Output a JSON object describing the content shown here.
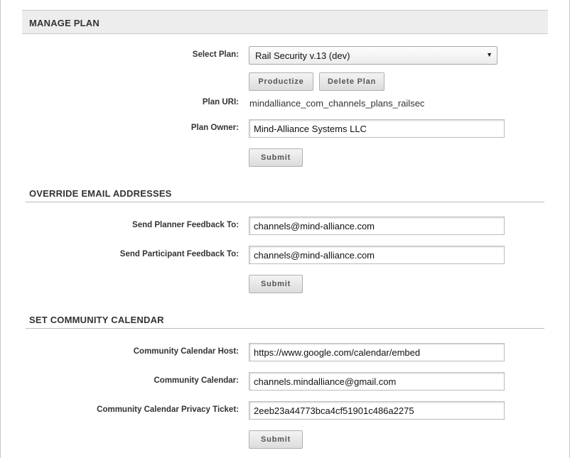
{
  "manage_plan": {
    "title": "MANAGE PLAN",
    "select_plan_label": "Select Plan:",
    "selected_plan": "Rail Security v.13 (dev)",
    "productize_label": "Productize",
    "delete_plan_label": "Delete Plan",
    "plan_uri_label": "Plan URI:",
    "plan_uri_value": "mindalliance_com_channels_plans_railsec",
    "plan_owner_label": "Plan Owner:",
    "plan_owner_value": "Mind-Alliance Systems LLC",
    "submit_label": "Submit"
  },
  "override_email": {
    "title": "OVERRIDE EMAIL ADDRESSES",
    "planner_feedback_label": "Send Planner Feedback To:",
    "planner_feedback_value": "channels@mind-alliance.com",
    "participant_feedback_label": "Send Participant Feedback To:",
    "participant_feedback_value": "channels@mind-alliance.com",
    "submit_label": "Submit"
  },
  "community_calendar": {
    "title": "SET COMMUNITY CALENDAR",
    "host_label": "Community Calendar Host:",
    "host_value": "https://www.google.com/calendar/embed",
    "calendar_label": "Community Calendar:",
    "calendar_value": "channels.mindalliance@gmail.com",
    "ticket_label": "Community Calendar Privacy Ticket:",
    "ticket_value": "2eeb23a44773bca4cf51901c486a2275",
    "submit_label": "Submit"
  },
  "icons": {
    "dropdown": "chevron-down-icon"
  }
}
